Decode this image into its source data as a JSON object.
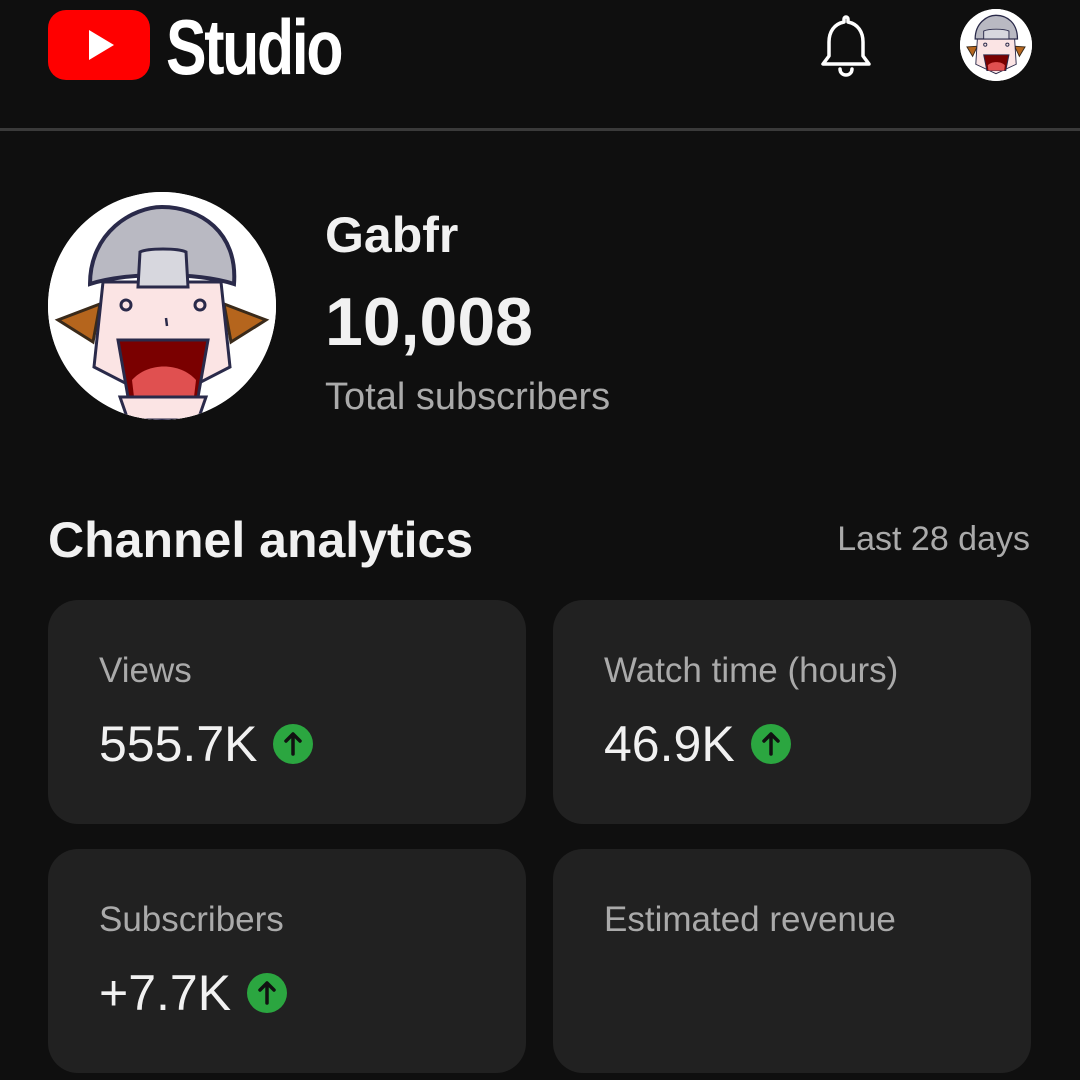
{
  "header": {
    "brand_text": "Studio",
    "notifications_icon": "bell-icon",
    "account_avatar": "cartoon-avatar"
  },
  "profile": {
    "channel_name": "Gabfr",
    "subscriber_count": "10,008",
    "subscriber_label": "Total subscribers"
  },
  "analytics": {
    "title": "Channel analytics",
    "period": "Last 28 days",
    "cards": [
      {
        "label": "Views",
        "value": "555.7K",
        "trend": "up"
      },
      {
        "label": "Watch time (hours)",
        "value": "46.9K",
        "trend": "up"
      },
      {
        "label": "Subscribers",
        "value": "+7.7K",
        "trend": "up"
      },
      {
        "label": "Estimated revenue",
        "value": "",
        "trend": ""
      }
    ]
  },
  "colors": {
    "background": "#0f0f0f",
    "card": "#212121",
    "brand_red": "#ff0000",
    "trend_up": "#2ba640",
    "secondary_text": "#aaaaaa"
  }
}
